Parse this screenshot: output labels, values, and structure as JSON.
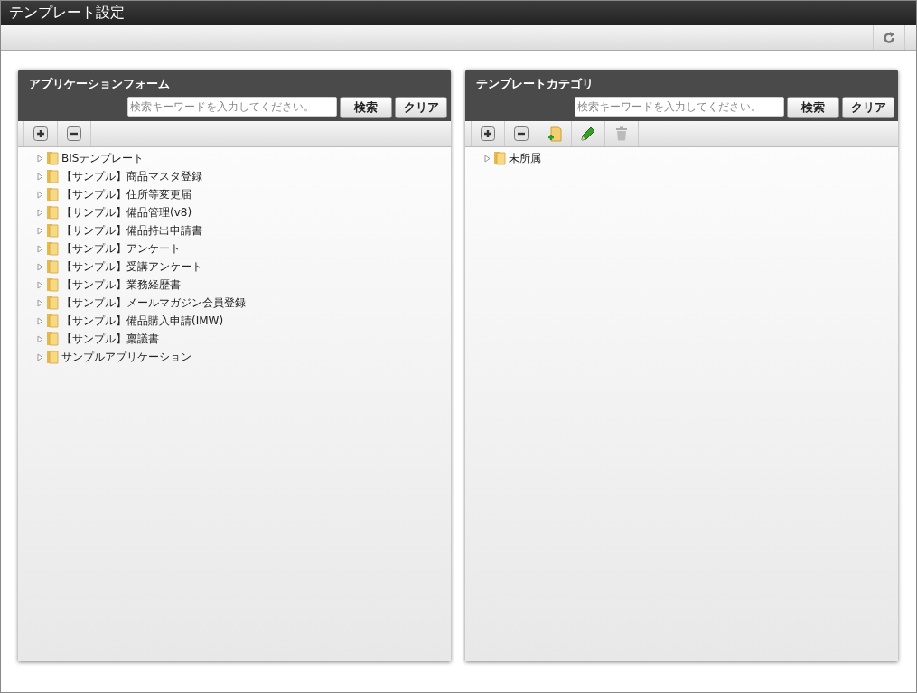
{
  "window": {
    "title": "テンプレート設定"
  },
  "panels": [
    {
      "title": "アプリケーションフォーム",
      "search": {
        "placeholder": "検索キーワードを入力してください。"
      },
      "buttons": [
        "検索",
        "クリア"
      ],
      "tools": [
        {
          "kind": "expand",
          "disabled": false
        },
        {
          "kind": "collapse",
          "disabled": false
        }
      ],
      "tree": [
        {
          "label": "BISテンプレート",
          "expanded": false
        },
        {
          "label": "【サンプル】商品マスタ登録",
          "expanded": false
        },
        {
          "label": "【サンプル】住所等変更届",
          "expanded": false
        },
        {
          "label": "【サンプル】備品管理(v8)",
          "expanded": false
        },
        {
          "label": "【サンプル】備品持出申請書",
          "expanded": false
        },
        {
          "label": "【サンプル】アンケート",
          "expanded": false
        },
        {
          "label": "【サンプル】受講アンケート",
          "expanded": false
        },
        {
          "label": "【サンプル】業務経歴書",
          "expanded": false
        },
        {
          "label": "【サンプル】メールマガジン会員登録",
          "expanded": false
        },
        {
          "label": "【サンプル】備品購入申請(IMW)",
          "expanded": false
        },
        {
          "label": "【サンプル】稟議書",
          "expanded": false
        },
        {
          "label": "サンプルアプリケーション",
          "expanded": false
        }
      ]
    },
    {
      "title": "テンプレートカテゴリ",
      "search": {
        "placeholder": "検索キーワードを入力してください。"
      },
      "buttons": [
        "検索",
        "クリア"
      ],
      "tools": [
        {
          "kind": "expand",
          "disabled": false
        },
        {
          "kind": "collapse",
          "disabled": false
        },
        {
          "kind": "add-folder",
          "disabled": false
        },
        {
          "kind": "edit",
          "disabled": false
        },
        {
          "kind": "delete",
          "disabled": true
        }
      ],
      "tree": [
        {
          "label": "未所属",
          "expanded": false
        }
      ]
    }
  ]
}
